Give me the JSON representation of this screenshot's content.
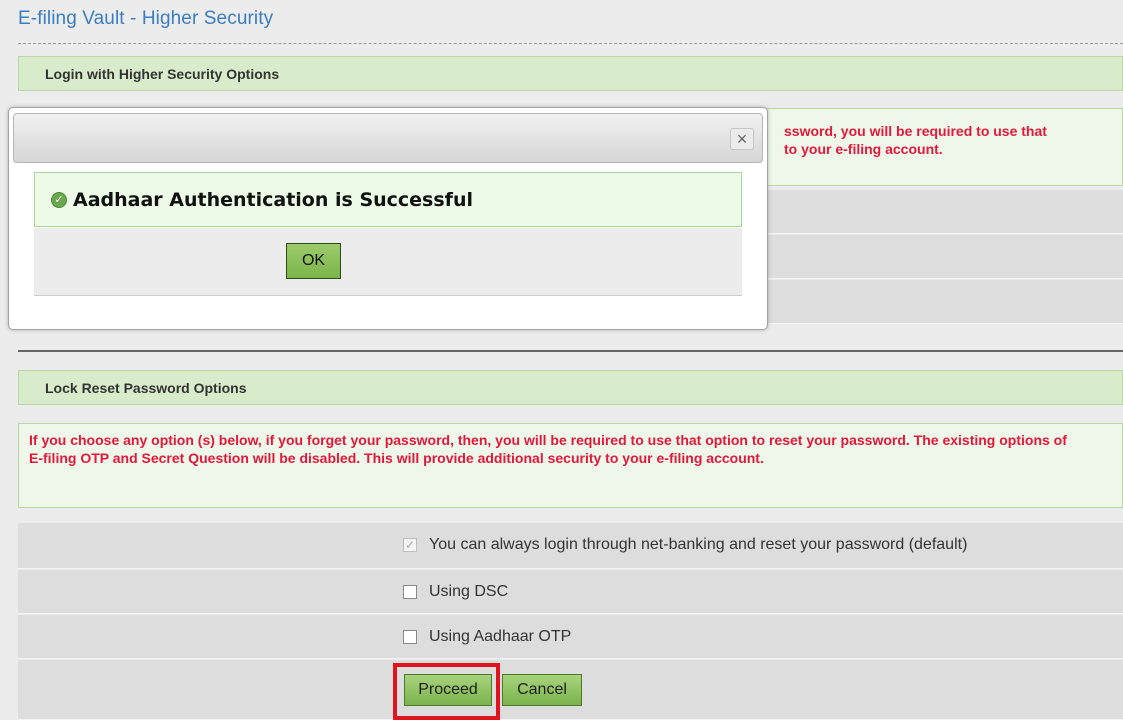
{
  "page": {
    "title": "E-filing Vault - Higher Security"
  },
  "login_section": {
    "header": "Login with Higher Security Options",
    "warning_visible_line1": "ssword, you will be required to use that",
    "warning_visible_line2": "to your e-filing account."
  },
  "reset_section": {
    "header": "Lock Reset Password Options",
    "warning": "If you choose any option (s) below, if you forget your password, then, you will be required to use that option to reset your password. The existing options of E-filing OTP and Secret Question will be disabled. This will provide additional security to your e-filing account.",
    "options": [
      {
        "label": "You can always login through net-banking and reset your password (default)",
        "checked": true,
        "disabled": true
      },
      {
        "label": "Using DSC",
        "checked": false,
        "disabled": false
      },
      {
        "label": "Using Aadhaar OTP",
        "checked": false,
        "disabled": false
      }
    ],
    "proceed_label": "Proceed",
    "cancel_label": "Cancel"
  },
  "dialog": {
    "close_symbol": "×",
    "message": "Aadhaar Authentication is Successful",
    "ok_label": "OK",
    "icon": "check-circle-icon"
  },
  "colors": {
    "warning_text": "#e3183a",
    "title_text": "#3a7dc0",
    "header_bg": "#d8eccb",
    "highlight": "#e0141e"
  }
}
